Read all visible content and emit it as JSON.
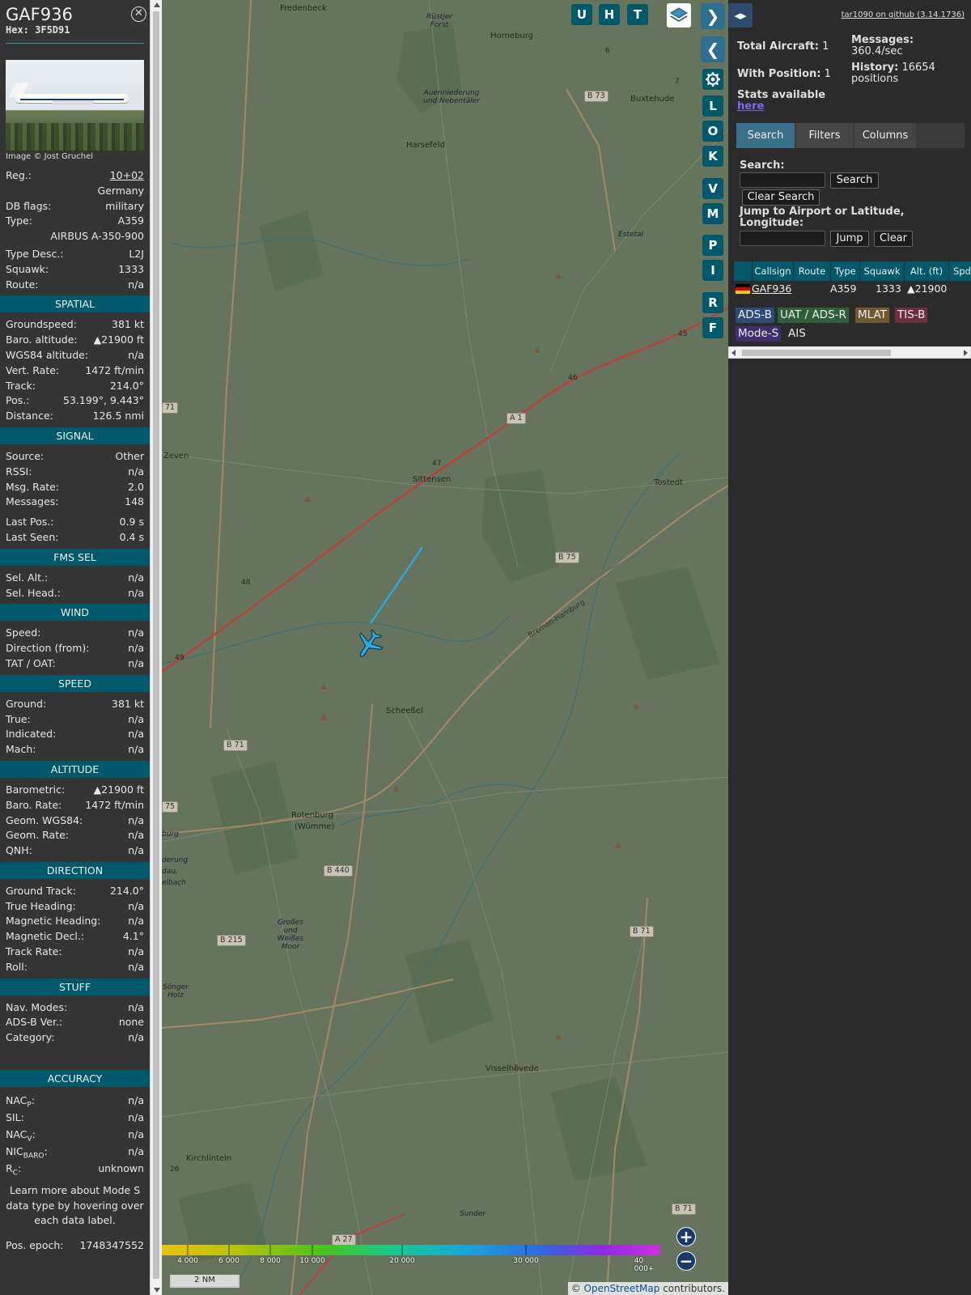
{
  "info": {
    "callsign": "GAF936",
    "hex": "Hex: 3F5D91",
    "close_icon": "close-icon",
    "photo_credit": "Image © Jost Gruchel",
    "registration": {
      "label": "Reg.:",
      "value": "10+02"
    },
    "country": "Germany",
    "db_flags": {
      "label": "DB flags:",
      "value": "military"
    },
    "type": {
      "label": "Type:",
      "value": "A359"
    },
    "type_full": "AIRBUS A-350-900",
    "type_desc": {
      "label": "Type Desc.:",
      "value": "L2J"
    },
    "squawk": {
      "label": "Squawk:",
      "value": "1333"
    },
    "route": {
      "label": "Route:",
      "value": "n/a"
    },
    "sections": {
      "spatial": "SPATIAL",
      "signal": "SIGNAL",
      "fms": "FMS SEL",
      "wind": "WIND",
      "speed": "SPEED",
      "altitude": "ALTITUDE",
      "direction": "DIRECTION",
      "stuff": "STUFF",
      "accuracy": "ACCURACY"
    },
    "spatial": [
      {
        "label": "Groundspeed:",
        "value": "381 kt"
      },
      {
        "label": "Baro. altitude:",
        "value": "▲21900 ft"
      },
      {
        "label": "WGS84 altitude:",
        "value": "n/a"
      },
      {
        "label": "Vert. Rate:",
        "value": "1472 ft/min"
      },
      {
        "label": "Track:",
        "value": "214.0°"
      },
      {
        "label": "Pos.:",
        "value": "53.199°, 9.443°"
      },
      {
        "label": "Distance:",
        "value": "126.5 nmi"
      }
    ],
    "signal": [
      {
        "label": "Source:",
        "value": "Other"
      },
      {
        "label": "RSSI:",
        "value": "n/a"
      },
      {
        "label": "Msg. Rate:",
        "value": "2.0"
      },
      {
        "label": "Messages:",
        "value": "148"
      },
      {
        "label": "Last Pos.:",
        "value": "0.9 s"
      },
      {
        "label": "Last Seen:",
        "value": "0.4 s"
      }
    ],
    "fms": [
      {
        "label": "Sel. Alt.:",
        "value": "n/a"
      },
      {
        "label": "Sel. Head.:",
        "value": "n/a"
      }
    ],
    "wind": [
      {
        "label": "Speed:",
        "value": "n/a"
      },
      {
        "label": "Direction (from):",
        "value": "n/a"
      },
      {
        "label": "TAT / OAT:",
        "value": "n/a"
      }
    ],
    "speed": [
      {
        "label": "Ground:",
        "value": "381 kt"
      },
      {
        "label": "True:",
        "value": "n/a"
      },
      {
        "label": "Indicated:",
        "value": "n/a"
      },
      {
        "label": "Mach:",
        "value": "n/a"
      }
    ],
    "altitude": [
      {
        "label": "Barometric:",
        "value": "▲21900 ft"
      },
      {
        "label": "Baro. Rate:",
        "value": "1472 ft/min"
      },
      {
        "label": "Geom. WGS84:",
        "value": "n/a"
      },
      {
        "label": "Geom. Rate:",
        "value": "n/a"
      },
      {
        "label": "QNH:",
        "value": "n/a"
      }
    ],
    "direction": [
      {
        "label": "Ground Track:",
        "value": "214.0°"
      },
      {
        "label": "True Heading:",
        "value": "n/a"
      },
      {
        "label": "Magnetic Heading:",
        "value": "n/a"
      },
      {
        "label": "Magnetic Decl.:",
        "value": "4.1°"
      },
      {
        "label": "Track Rate:",
        "value": "n/a"
      },
      {
        "label": "Roll:",
        "value": "n/a"
      }
    ],
    "stuff": [
      {
        "label": "Nav. Modes:",
        "value": "n/a"
      },
      {
        "label": "ADS-B Ver.:",
        "value": "none"
      },
      {
        "label": "Category:",
        "value": "n/a"
      }
    ],
    "accuracy": {
      "nacp": {
        "label": "NAC",
        "sub": "P",
        "value": "n/a"
      },
      "sil": {
        "label": "SIL:",
        "value": "n/a"
      },
      "nacv": {
        "label": "NAC",
        "sub": "V",
        "value": "n/a"
      },
      "nic": {
        "label": "NIC",
        "sub": "BARO",
        "value": "n/a"
      },
      "rc": {
        "label": "R",
        "sub": "C",
        "value": "unknown"
      }
    },
    "note": "Learn more about Mode S data type by hovering over each data label.",
    "epoch": {
      "label": "Pos. epoch:",
      "value": "1748347552"
    }
  },
  "map": {
    "places": [
      "Fredenbeck",
      "Horneburg",
      "Buxtehude",
      "Harsefeld",
      "Zeven",
      "Sittensen",
      "Tostedt",
      "Scheeßel",
      "Rotenburg",
      "(Wümme)",
      "Visselhövede",
      "Kirchlinteln",
      "Sunder",
      "Estetal"
    ],
    "nature": [
      "Rüstjer Forst",
      "Auenniederung und Nebentäler",
      "Großes und Weißes Moor",
      "Bremen-Hamburg",
      "derung",
      "dau,",
      "elbach",
      "burg",
      "Sönger Holz"
    ],
    "roads": [
      "B 73",
      "A 1",
      "B 75",
      "B 71",
      "B 71",
      "75",
      "B 440",
      "B 215",
      "B 71",
      "B 440",
      "A 27",
      "71"
    ],
    "road_numbers": [
      "6",
      "7",
      "45",
      "46",
      "47",
      "48",
      "49",
      "26"
    ],
    "buttons": {
      "u": "U",
      "h": "H",
      "t": "T",
      "l": "L",
      "o": "O",
      "k": "K",
      "v": "V",
      "m": "M",
      "p": "P",
      "i": "I",
      "r": "R",
      "f": "F"
    },
    "icons": {
      "layers": "layers-icon",
      "next": "chevron-right-icon",
      "prev": "chevron-left-icon",
      "settings": "gear-icon",
      "zoom_in": "plus-icon",
      "zoom_out": "minus-icon",
      "aircraft": "airplane-icon"
    },
    "altitude_ticks": [
      "4 000",
      "6 000",
      "8 000",
      "10 000",
      "20 000",
      "30 000",
      "40 000+"
    ],
    "scale": "2 NM",
    "attribution_prefix": "© ",
    "attribution_link": "OpenStreetMap",
    "attribution_suffix": " contributors."
  },
  "side": {
    "toggle_icon": "expand-collapse-icon",
    "github": "tar1090 on github (3.14.1736)",
    "stats": {
      "total_label": "Total Aircraft:",
      "total_value": "1",
      "messages_label": "Messages:",
      "messages_value": "360.4/sec",
      "position_label": "With Position:",
      "position_value": "1",
      "history_label": "History:",
      "history_value": "16654",
      "history_unit": "positions",
      "stats_label": "Stats available",
      "stats_link": "here"
    },
    "tabs": [
      "Search",
      "Filters",
      "Columns"
    ],
    "search": {
      "label": "Search:",
      "button": "Search",
      "clear": "Clear Search",
      "jump_label_1": "Jump to Airport or Latitude,",
      "jump_label_2": "Longitude:",
      "jump_button": "Jump",
      "jump_clear": "Clear",
      "value": "",
      "jump_value": ""
    },
    "table": {
      "headers": [
        "Callsign",
        "Route",
        "Type",
        "Squawk",
        "Alt. (ft)",
        "Spd"
      ],
      "row": {
        "callsign": "GAF936",
        "route": "",
        "type": "A359",
        "squawk": "1333",
        "alt": "▲21900"
      }
    },
    "sources": [
      "ADS-B",
      "UAT / ADS-R",
      "MLAT",
      "TIS-B",
      "Mode-S",
      "AIS"
    ],
    "colors": {
      "adsb": "#2c4a7a",
      "uat": "#2e5e3a",
      "mlat": "#6e5a2e",
      "tisb": "#6e2e3e",
      "modes": "#3e2e6e",
      "accent": "#00596b"
    }
  }
}
